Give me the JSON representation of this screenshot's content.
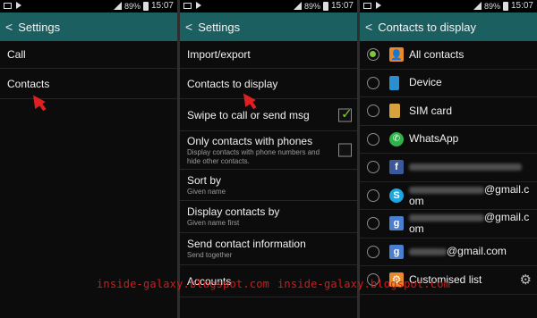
{
  "status_bar": {
    "battery": "89%",
    "time": "15:07"
  },
  "panel1": {
    "title": "Settings",
    "items": [
      {
        "title": "Call"
      },
      {
        "title": "Contacts"
      }
    ]
  },
  "panel2": {
    "title": "Settings",
    "items": [
      {
        "title": "Import/export"
      },
      {
        "title": "Contacts to display"
      },
      {
        "title": "Swipe to call or send msg",
        "checked": true
      },
      {
        "title": "Only contacts with phones",
        "subtitle": "Display contacts with phone numbers and hide other contacts.",
        "checked": false
      },
      {
        "title": "Sort by",
        "subtitle": "Given name"
      },
      {
        "title": "Display contacts by",
        "subtitle": "Given name first"
      },
      {
        "title": "Send contact information",
        "subtitle": "Send together"
      },
      {
        "title": "Accounts"
      }
    ]
  },
  "panel3": {
    "title": "Contacts to display",
    "items": [
      {
        "label": "All contacts",
        "icon": "person-icon",
        "selected": true
      },
      {
        "label": "Device",
        "icon": "phone-icon"
      },
      {
        "label": "SIM card",
        "icon": "sim-card-icon"
      },
      {
        "label": "WhatsApp",
        "icon": "whatsapp-icon"
      },
      {
        "label": "",
        "icon": "facebook-icon"
      },
      {
        "label_line1": "@gmail.c",
        "label_line2": "om",
        "icon": "skype-icon"
      },
      {
        "label_line1": "@gmail.c",
        "label_line2": "om",
        "icon": "google-icon"
      },
      {
        "label": "@gmail.com",
        "icon": "google-icon"
      },
      {
        "label": "Customised list",
        "icon": "gear-small-icon"
      }
    ]
  },
  "watermark": "inside-galaxy.blogspot.com",
  "colors": {
    "action_bar": "#1c5f61",
    "accent_green": "#7ec63a",
    "pointer_red": "#e02020"
  }
}
